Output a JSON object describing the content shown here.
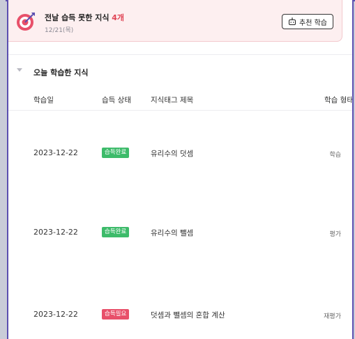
{
  "alert": {
    "title": "전날 습득 못한 지식 ",
    "count": "4개",
    "date": "12/21(목)",
    "button_label": "추천 학습",
    "count_color": "#e04455"
  },
  "section": {
    "title": "오늘 학습한 지식"
  },
  "table": {
    "headers": {
      "date": "학습일",
      "status": "습득 상태",
      "title": "지식태그 제목",
      "type": "학습 형태"
    },
    "rows": [
      {
        "date": "2023-12-22",
        "status": "습득완료",
        "status_kind": "done",
        "title": "유리수의 덧셈",
        "type": "학습"
      },
      {
        "date": "2023-12-22",
        "status": "습득완료",
        "status_kind": "done",
        "title": "유리수의 뺄셈",
        "type": "평가"
      },
      {
        "date": "2023-12-22",
        "status": "습득필요",
        "status_kind": "need",
        "title": "덧셈과 뺄셈의 혼합 계산",
        "type": "재평가"
      }
    ]
  },
  "colors": {
    "done_badge": "#3dbb6a",
    "need_badge": "#e8506a",
    "frame_accent": "#5b4fb0",
    "alert_bg": "#fdeff0"
  }
}
